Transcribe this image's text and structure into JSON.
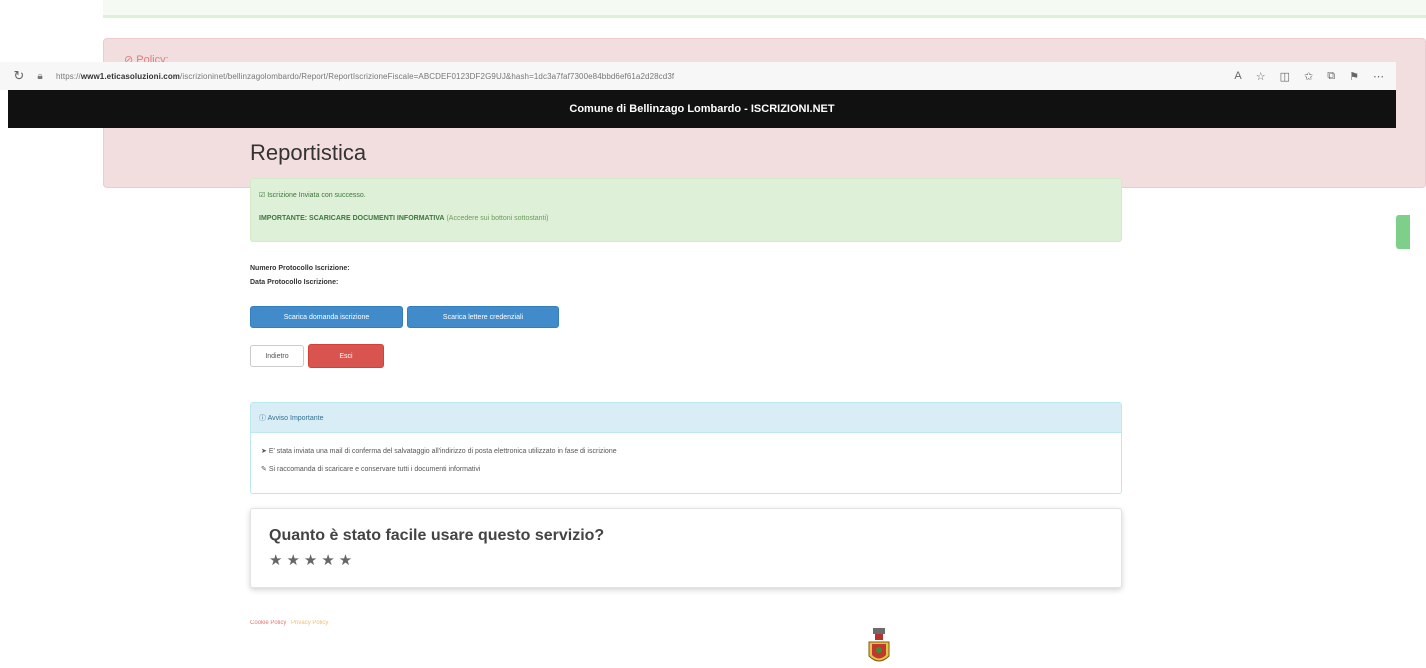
{
  "background": {
    "error_title": "⊘ Policy:"
  },
  "browser": {
    "url_prefix": "https://",
    "url_host": "www1.eticasoluzioni.com",
    "url_rest": "/iscrizioninet/bellinzagolombardo/Report/ReportIscrizioneFiscale=ABCDEF0123DF2G9UJ&hash=1dc3a7faf7300e84bbd6ef61a2d28cd3f"
  },
  "header": {
    "title": "Comune di Bellinzago Lombardo - ISCRIZIONI.NET"
  },
  "page": {
    "title": "Reportistica"
  },
  "success_alert": {
    "message": "Iscrizione Inviata con successo.",
    "important_label": "IMPORTANTE: SCARICARE DOCUMENTI INFORMATIVA",
    "important_note": "(Accedere sui bottoni sottostanti)"
  },
  "protocol": {
    "number_label": "Numero Protocollo Iscrizione:",
    "date_label": "Data Protocollo Iscrizione:"
  },
  "buttons": {
    "download_domanda": "Scarica domanda iscrizione",
    "download_lettere": "Scarica lettere credenziali",
    "indietro": "Indietro",
    "esci": "Esci"
  },
  "notice": {
    "heading": "Avviso Importante",
    "line1": "E' stata inviata una mail di conferma del salvataggio all'indirizzo di posta elettronica utilizzato in fase di iscrizione",
    "line2": "Si raccomanda di scaricare e conservare tutti i documenti informativi"
  },
  "rating": {
    "question": "Quanto è stato facile usare questo servizio?",
    "stars": "★★★★★",
    "max": 5
  },
  "footer": {
    "link1": "Cookie Policy",
    "link2": "Privacy Policy"
  },
  "colors": {
    "header_bg": "#111111",
    "success_bg": "#dff0d8",
    "primary": "#428bca",
    "danger": "#d9534f",
    "info_bg": "#d9edf7"
  }
}
